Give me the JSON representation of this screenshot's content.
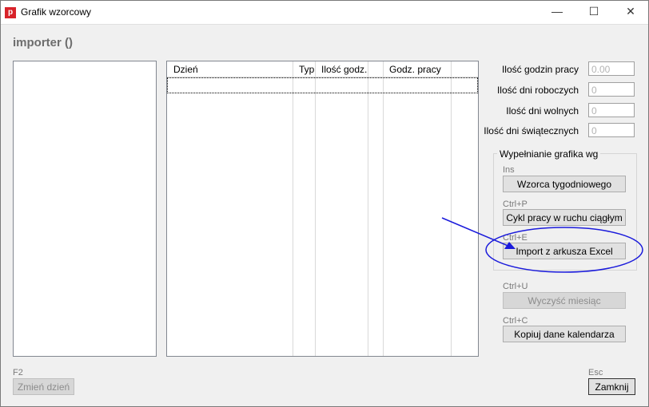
{
  "window": {
    "app_icon_letter": "p",
    "title": "Grafik wzorcowy",
    "minimize_glyph": "—",
    "maximize_glyph": "☐",
    "close_glyph": "✕"
  },
  "page_title": "importer ()",
  "grid": {
    "columns": [
      "Dzień",
      "Typ",
      "Ilość godz.",
      "",
      "Godz. pracy"
    ],
    "rows": []
  },
  "stats": [
    {
      "label": "Ilość godzin pracy",
      "value": "0.00"
    },
    {
      "label": "Ilość dni roboczych",
      "value": "0"
    },
    {
      "label": "Ilość dni wolnych",
      "value": "0"
    },
    {
      "label": "Ilość dni świątecznych",
      "value": "0"
    }
  ],
  "fill_group": {
    "title": "Wypełnianie grafika wg",
    "weekly": {
      "shortcut": "Ins",
      "label": "Wzorca tygodniowego"
    },
    "continuous": {
      "shortcut": "Ctrl+P",
      "label": "Cykl pracy w ruchu ciągłym"
    },
    "excel": {
      "shortcut": "Ctrl+E",
      "label": "Import z arkusza Excel"
    }
  },
  "clear_month": {
    "shortcut": "Ctrl+U",
    "label": "Wyczyść miesiąc",
    "disabled": true
  },
  "copy_calendar": {
    "shortcut": "Ctrl+C",
    "label": "Kopiuj dane kalendarza"
  },
  "change_day": {
    "shortcut": "F2",
    "label": "Zmień dzień",
    "disabled": true
  },
  "close": {
    "shortcut": "Esc",
    "label": "Zamknij"
  },
  "colors": {
    "annotation": "#1a1adb",
    "disabled_text": "#8c8c8c",
    "title_gray": "#6d6d6d"
  }
}
